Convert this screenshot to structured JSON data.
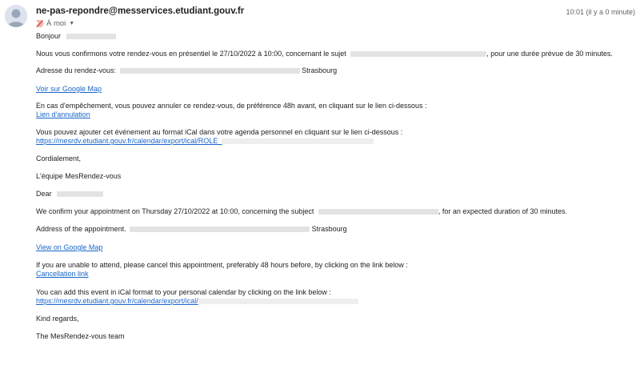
{
  "header": {
    "sender": "ne-pas-repondre@messervices.etudiant.gouv.fr",
    "recipient": "À moi",
    "timestamp": "10:01 (il y a 0 minute)"
  },
  "fr": {
    "greeting": "Bonjour",
    "confirm_before": "Nous vous confirmons votre rendez-vous en présentiel le 27/10/2022 à 10:00, concernant le sujet",
    "confirm_after": ", pour une durée prévue de 30 minutes.",
    "address_label": "Adresse du rendez-vous:",
    "address_city": "Strasbourg",
    "map_link": "Voir sur Google Map",
    "cancel_text": "En cas d'empêchement, vous pouvez annuler ce rendez-vous, de préférence 48h avant, en cliquant sur le lien ci-dessous :",
    "cancel_link": "Lien d'annulation",
    "ical_text": "Vous pouvez ajouter cet événement au format iCal dans votre agenda personnel en cliquant sur le lien ci-dessous :",
    "ical_link": "https://mesrdv.etudiant.gouv.fr/calendar/export/ical/ROLE_",
    "closing": "Cordialement,",
    "signature": "L'équipe MesRendez-vous"
  },
  "en": {
    "greeting": "Dear",
    "confirm_before": "We confirm your appointment on Thursday 27/10/2022 at 10:00, concerning the subject",
    "confirm_after": ", for an expected duration of 30 minutes.",
    "address_label": "Address of the appointment.",
    "address_city": "Strasbourg",
    "map_link": "View on Google Map",
    "cancel_text": "If you are unable to attend, please cancel this appointment, preferably 48 hours before, by clicking on the link below :",
    "cancel_link": "Cancellation link",
    "ical_text": "You can add this event in iCal format to your personal calendar by clicking on the link below :",
    "ical_link": "https://mesrdv.etudiant.gouv.fr/calendar/export/ical/",
    "closing": "Kind regards,",
    "signature": "The MesRendez-vous team"
  },
  "colors": {
    "link": "#1a66c9",
    "text": "#222222",
    "muted": "#5f6368",
    "important_marker": "#d93025"
  },
  "icons": {
    "avatar": "default-person-avatar",
    "important": "important-marker-icon",
    "caret": "caret-down-icon"
  }
}
